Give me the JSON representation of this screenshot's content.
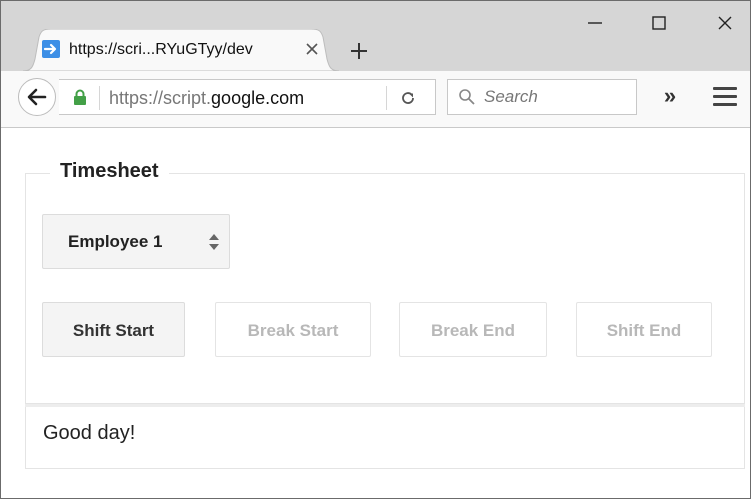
{
  "browser": {
    "tab": {
      "title": "https://scri...RYuGTyy/dev",
      "favicon": "apps-script-arrow-icon"
    },
    "window_controls": [
      "minimize-icon",
      "maximize-icon",
      "close-icon"
    ],
    "url": {
      "prefix": "https://script.",
      "domain": "google.com"
    },
    "search": {
      "placeholder": "Search"
    },
    "toolbar_overflow_label": "»"
  },
  "timesheet": {
    "legend": "Timesheet",
    "employee_select": {
      "selected": "Employee 1"
    },
    "buttons": [
      {
        "label": "Shift Start",
        "enabled": true
      },
      {
        "label": "Break Start",
        "enabled": false
      },
      {
        "label": "Break End",
        "enabled": false
      },
      {
        "label": "Shift End",
        "enabled": false
      }
    ],
    "message": "Good day!"
  },
  "colors": {
    "tab_strip": "#d6d6d6",
    "favicon_blue": "#3d8fe6",
    "lock_green": "#43a047",
    "active_button_bg": "#f4f4f4",
    "disabled_text": "#b8b8b8"
  }
}
